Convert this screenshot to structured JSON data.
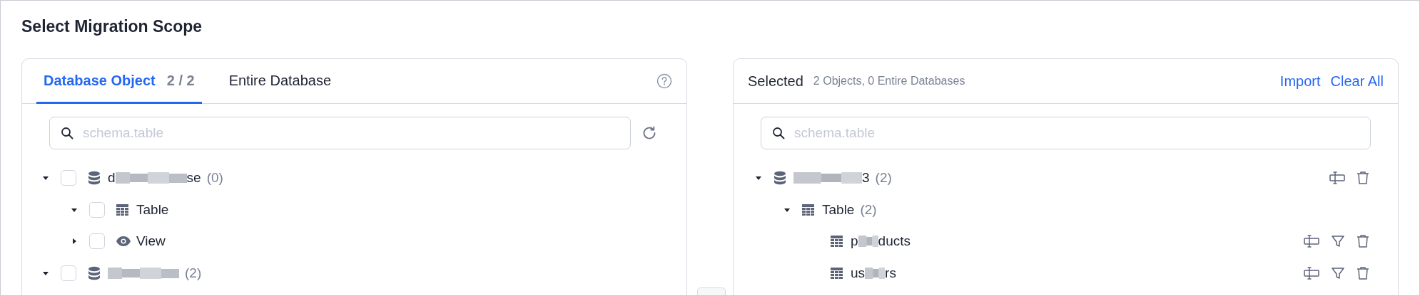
{
  "title": "Select Migration Scope",
  "left": {
    "tabs": [
      {
        "label": "Database Object",
        "count": "2 / 2",
        "selected": true
      },
      {
        "label": "Entire Database",
        "selected": false
      }
    ],
    "search": {
      "placeholder": "schema.table"
    },
    "tree": [
      {
        "kind": "database",
        "label_start": "d",
        "blurred": true,
        "label_end": "se",
        "count": "(0)",
        "checked": false,
        "expanded": true,
        "children": [
          {
            "kind": "table",
            "label_start": "Table",
            "checked": false,
            "expanded": true
          },
          {
            "kind": "view",
            "label_start": "View",
            "checked": false,
            "expanded": false
          }
        ]
      },
      {
        "kind": "database",
        "blurred": true,
        "count": "(2)",
        "checked": false,
        "expanded": true
      }
    ]
  },
  "right": {
    "title": "Selected",
    "summary": "2 Objects, 0 Entire Databases",
    "actions": [
      "Import",
      "Clear All"
    ],
    "search": {
      "placeholder": "schema.table"
    },
    "tree": [
      {
        "kind": "database",
        "blurred": true,
        "label_end": "3",
        "count": "(2)",
        "expanded": true,
        "actions": [
          {
            "kind": "rename"
          },
          {
            "kind": "delete"
          }
        ],
        "children": [
          {
            "kind": "table",
            "label_start": "Table",
            "count": "(2)",
            "expanded": true,
            "children": [
              {
                "kind": "table",
                "label_start": "p",
                "blurred": true,
                "label_end": "ducts",
                "actions": [
                  {
                    "kind": "rename"
                  },
                  {
                    "kind": "filter"
                  },
                  {
                    "kind": "delete"
                  }
                ]
              },
              {
                "kind": "table",
                "label_start": "us",
                "blurred": true,
                "label_end": "rs",
                "actions": [
                  {
                    "kind": "rename"
                  },
                  {
                    "kind": "filter"
                  },
                  {
                    "kind": "delete"
                  }
                ]
              }
            ]
          }
        ]
      }
    ]
  }
}
